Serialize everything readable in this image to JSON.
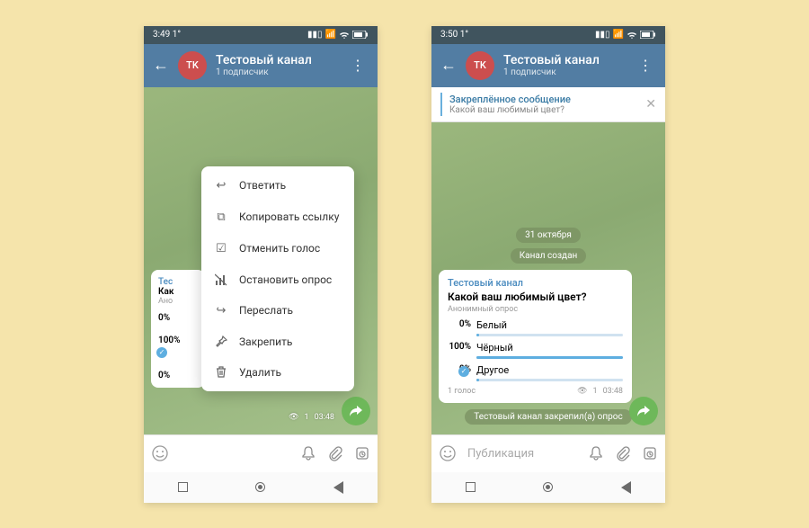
{
  "left": {
    "status_time": "3:49 1°",
    "chat_title": "Тестовый канал",
    "chat_sub": "1 подписчик",
    "partial_channel": "Тес",
    "partial_q": "Как",
    "partial_type": "Ано",
    "partial_r1": "0%",
    "partial_r2": "100%",
    "msg_views": "1",
    "msg_time": "03:48",
    "menu": {
      "reply": "Ответить",
      "copy_link": "Копировать ссылку",
      "cancel_vote": "Отменить голос",
      "stop_poll": "Остановить опрос",
      "forward": "Переслать",
      "pin": "Закрепить",
      "delete": "Удалить"
    }
  },
  "right": {
    "status_time": "3:50 1°",
    "chat_title": "Тестовый канал",
    "chat_sub": "1 подписчик",
    "pinned_title": "Закреплённое сообщение",
    "pinned_sub": "Какой ваш любимый цвет?",
    "date": "31 октября",
    "service1": "Канал создан",
    "msg_channel": "Тестовый канал",
    "msg_question": "Какой ваш любимый цвет?",
    "msg_polltype": "Анонимный опрос",
    "opt1_pct": "0%",
    "opt1": "Белый",
    "opt2_pct": "100%",
    "opt2": "Чёрный",
    "opt3_pct": "0%",
    "opt3": "Другое",
    "msg_votes": "1 голос",
    "msg_views": "1",
    "msg_time": "03:48",
    "service2": "Тестовый канал закрепил(а) опрос",
    "input_placeholder": "Публикация"
  }
}
